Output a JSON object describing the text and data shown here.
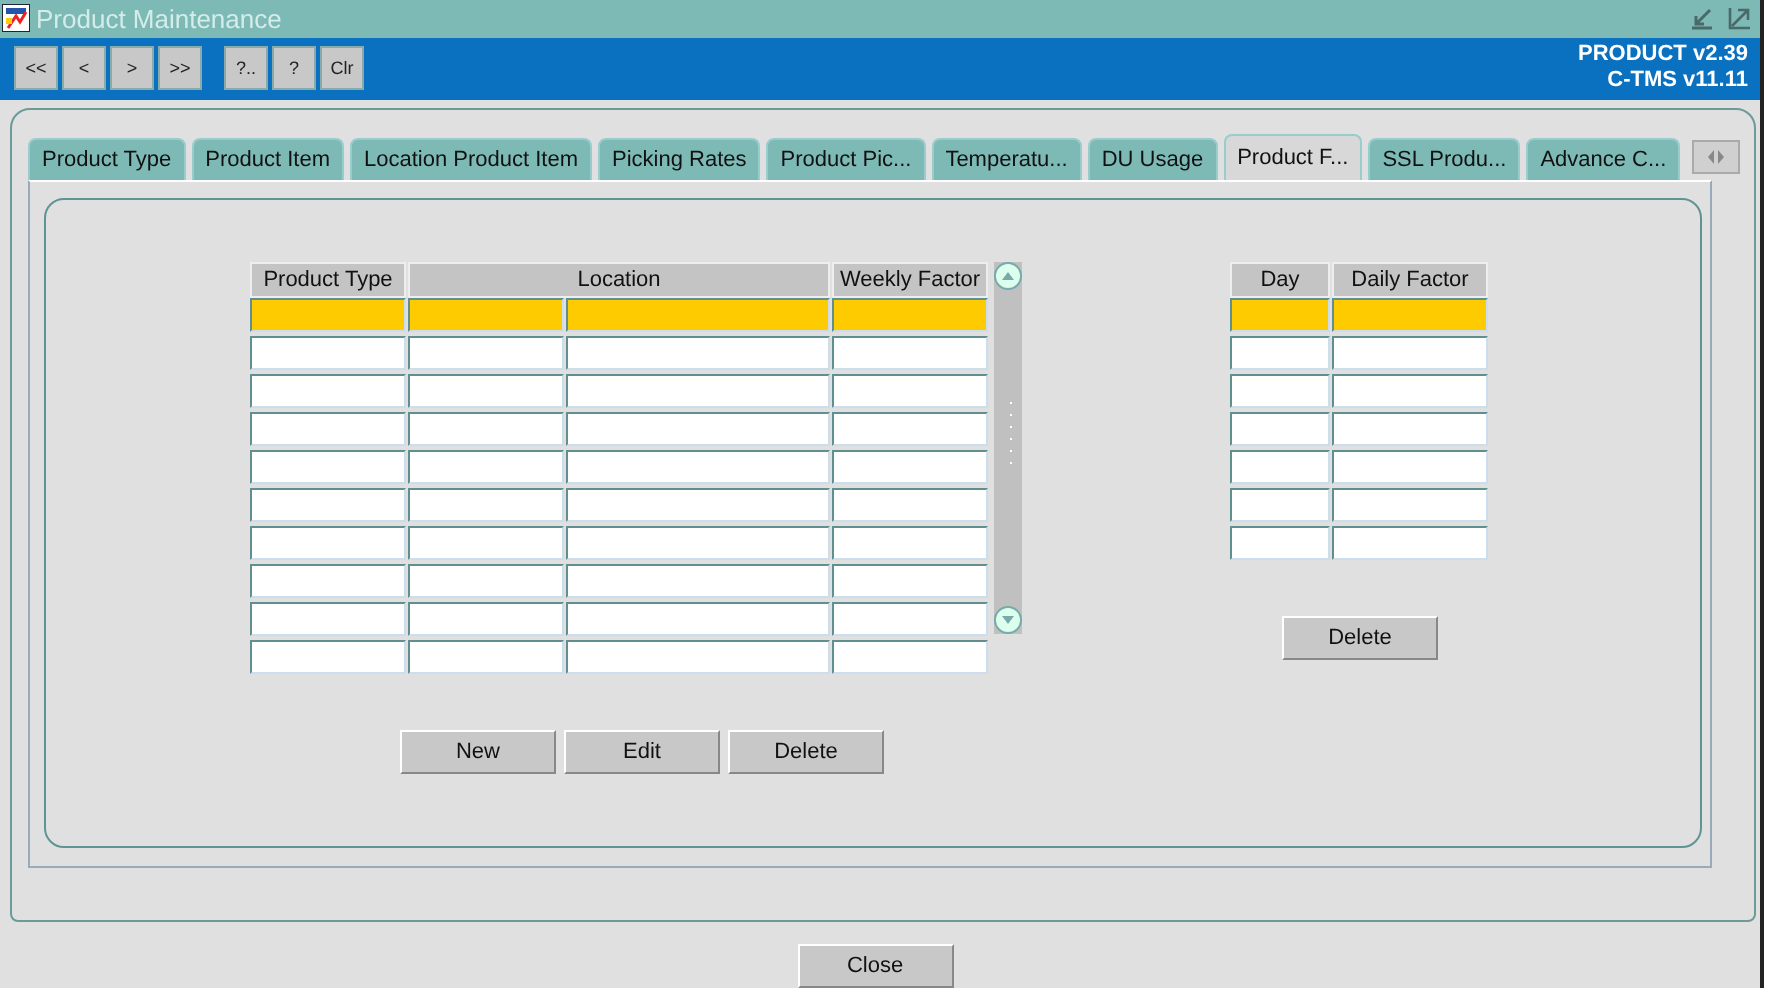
{
  "window": {
    "title": "Product Maintenance"
  },
  "toolbar": {
    "buttons": [
      "<<",
      "<",
      ">",
      ">>",
      "?..",
      "?",
      "Clr"
    ],
    "version_lines": [
      "PRODUCT v2.39",
      "C-TMS v11.11"
    ]
  },
  "tabs": [
    {
      "label": "Product Type",
      "selected": false
    },
    {
      "label": "Product Item",
      "selected": false
    },
    {
      "label": "Location Product Item",
      "selected": false
    },
    {
      "label": "Picking Rates",
      "selected": false
    },
    {
      "label": "Product Pic...",
      "selected": false
    },
    {
      "label": "Temperatu...",
      "selected": false
    },
    {
      "label": "DU Usage",
      "selected": false
    },
    {
      "label": "Product F...",
      "selected": true
    },
    {
      "label": "SSL Produ...",
      "selected": false
    },
    {
      "label": "Advance C...",
      "selected": false
    }
  ],
  "weekly_table": {
    "columns": [
      "Product Type",
      "Location",
      "Weekly Factor"
    ],
    "rows": [
      {
        "selected": true
      },
      {
        "selected": false
      },
      {
        "selected": false
      },
      {
        "selected": false
      },
      {
        "selected": false
      },
      {
        "selected": false
      },
      {
        "selected": false
      },
      {
        "selected": false
      },
      {
        "selected": false
      },
      {
        "selected": false
      }
    ],
    "buttons": [
      "New",
      "Edit",
      "Delete"
    ]
  },
  "daily_table": {
    "columns": [
      "Day",
      "Daily Factor"
    ],
    "rows": [
      {
        "selected": true
      },
      {
        "selected": false
      },
      {
        "selected": false
      },
      {
        "selected": false
      },
      {
        "selected": false
      },
      {
        "selected": false
      },
      {
        "selected": false
      }
    ],
    "buttons": [
      "Delete"
    ]
  },
  "footer_buttons": [
    "Close"
  ]
}
